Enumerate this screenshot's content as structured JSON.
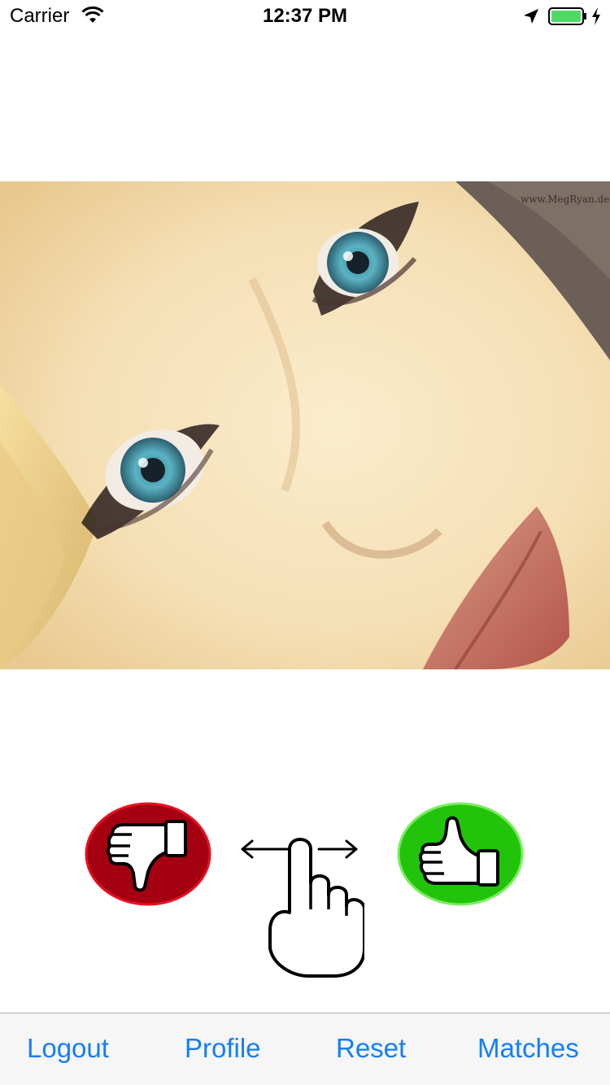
{
  "status_bar": {
    "carrier": "Carrier",
    "time": "12:37 PM",
    "icons": [
      "wifi-icon",
      "location-arrow-icon",
      "battery-icon",
      "charging-bolt-icon"
    ],
    "battery_color": "#4cd964"
  },
  "photo": {
    "watermark": "www.MegRyan.de"
  },
  "actions": {
    "dislike_icon": "thumbs-down-icon",
    "dislike_color": "#a40012",
    "like_icon": "thumbs-up-icon",
    "like_color": "#21c40a",
    "swipe_hint_icon": "swipe-hand-icon"
  },
  "toolbar": {
    "logout_label": "Logout",
    "profile_label": "Profile",
    "reset_label": "Reset",
    "matches_label": "Matches",
    "tint_color": "#147efb"
  }
}
